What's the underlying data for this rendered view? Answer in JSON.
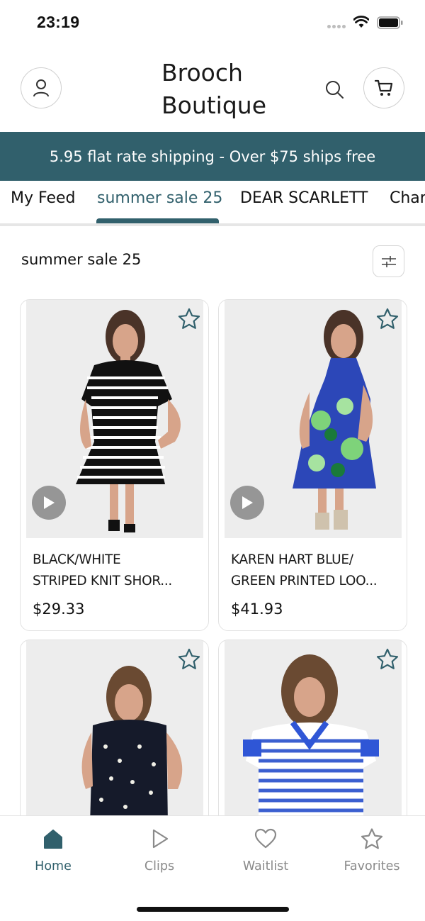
{
  "status": {
    "time": "23:19"
  },
  "header": {
    "brand_line1": "Brooch",
    "brand_line2": "Boutique"
  },
  "banner": {
    "text": "5.95 flat rate shipping - Over $75 ships free"
  },
  "tabs": [
    {
      "label": "My Feed"
    },
    {
      "label": "summer sale 25"
    },
    {
      "label": "DEAR SCARLETT"
    },
    {
      "label": "Char"
    }
  ],
  "section": {
    "title": "summer sale 25"
  },
  "products": [
    {
      "name_line1": "BLACK/WHITE",
      "name_line2": "STRIPED KNIT SHOR...",
      "price": "$29.33"
    },
    {
      "name_line1": "KAREN HART BLUE/",
      "name_line2": "GREEN PRINTED LOO...",
      "price": "$41.93"
    },
    {
      "name_line1": "",
      "name_line2": "",
      "price": ""
    },
    {
      "name_line1": "",
      "name_line2": "",
      "price": ""
    }
  ],
  "nav": [
    {
      "label": "Home",
      "icon": "home-icon"
    },
    {
      "label": "Clips",
      "icon": "play-icon"
    },
    {
      "label": "Waitlist",
      "icon": "heart-icon"
    },
    {
      "label": "Favorites",
      "icon": "star-icon"
    }
  ],
  "colors": {
    "accent": "#31606c",
    "inactive": "#8a8a8a"
  }
}
